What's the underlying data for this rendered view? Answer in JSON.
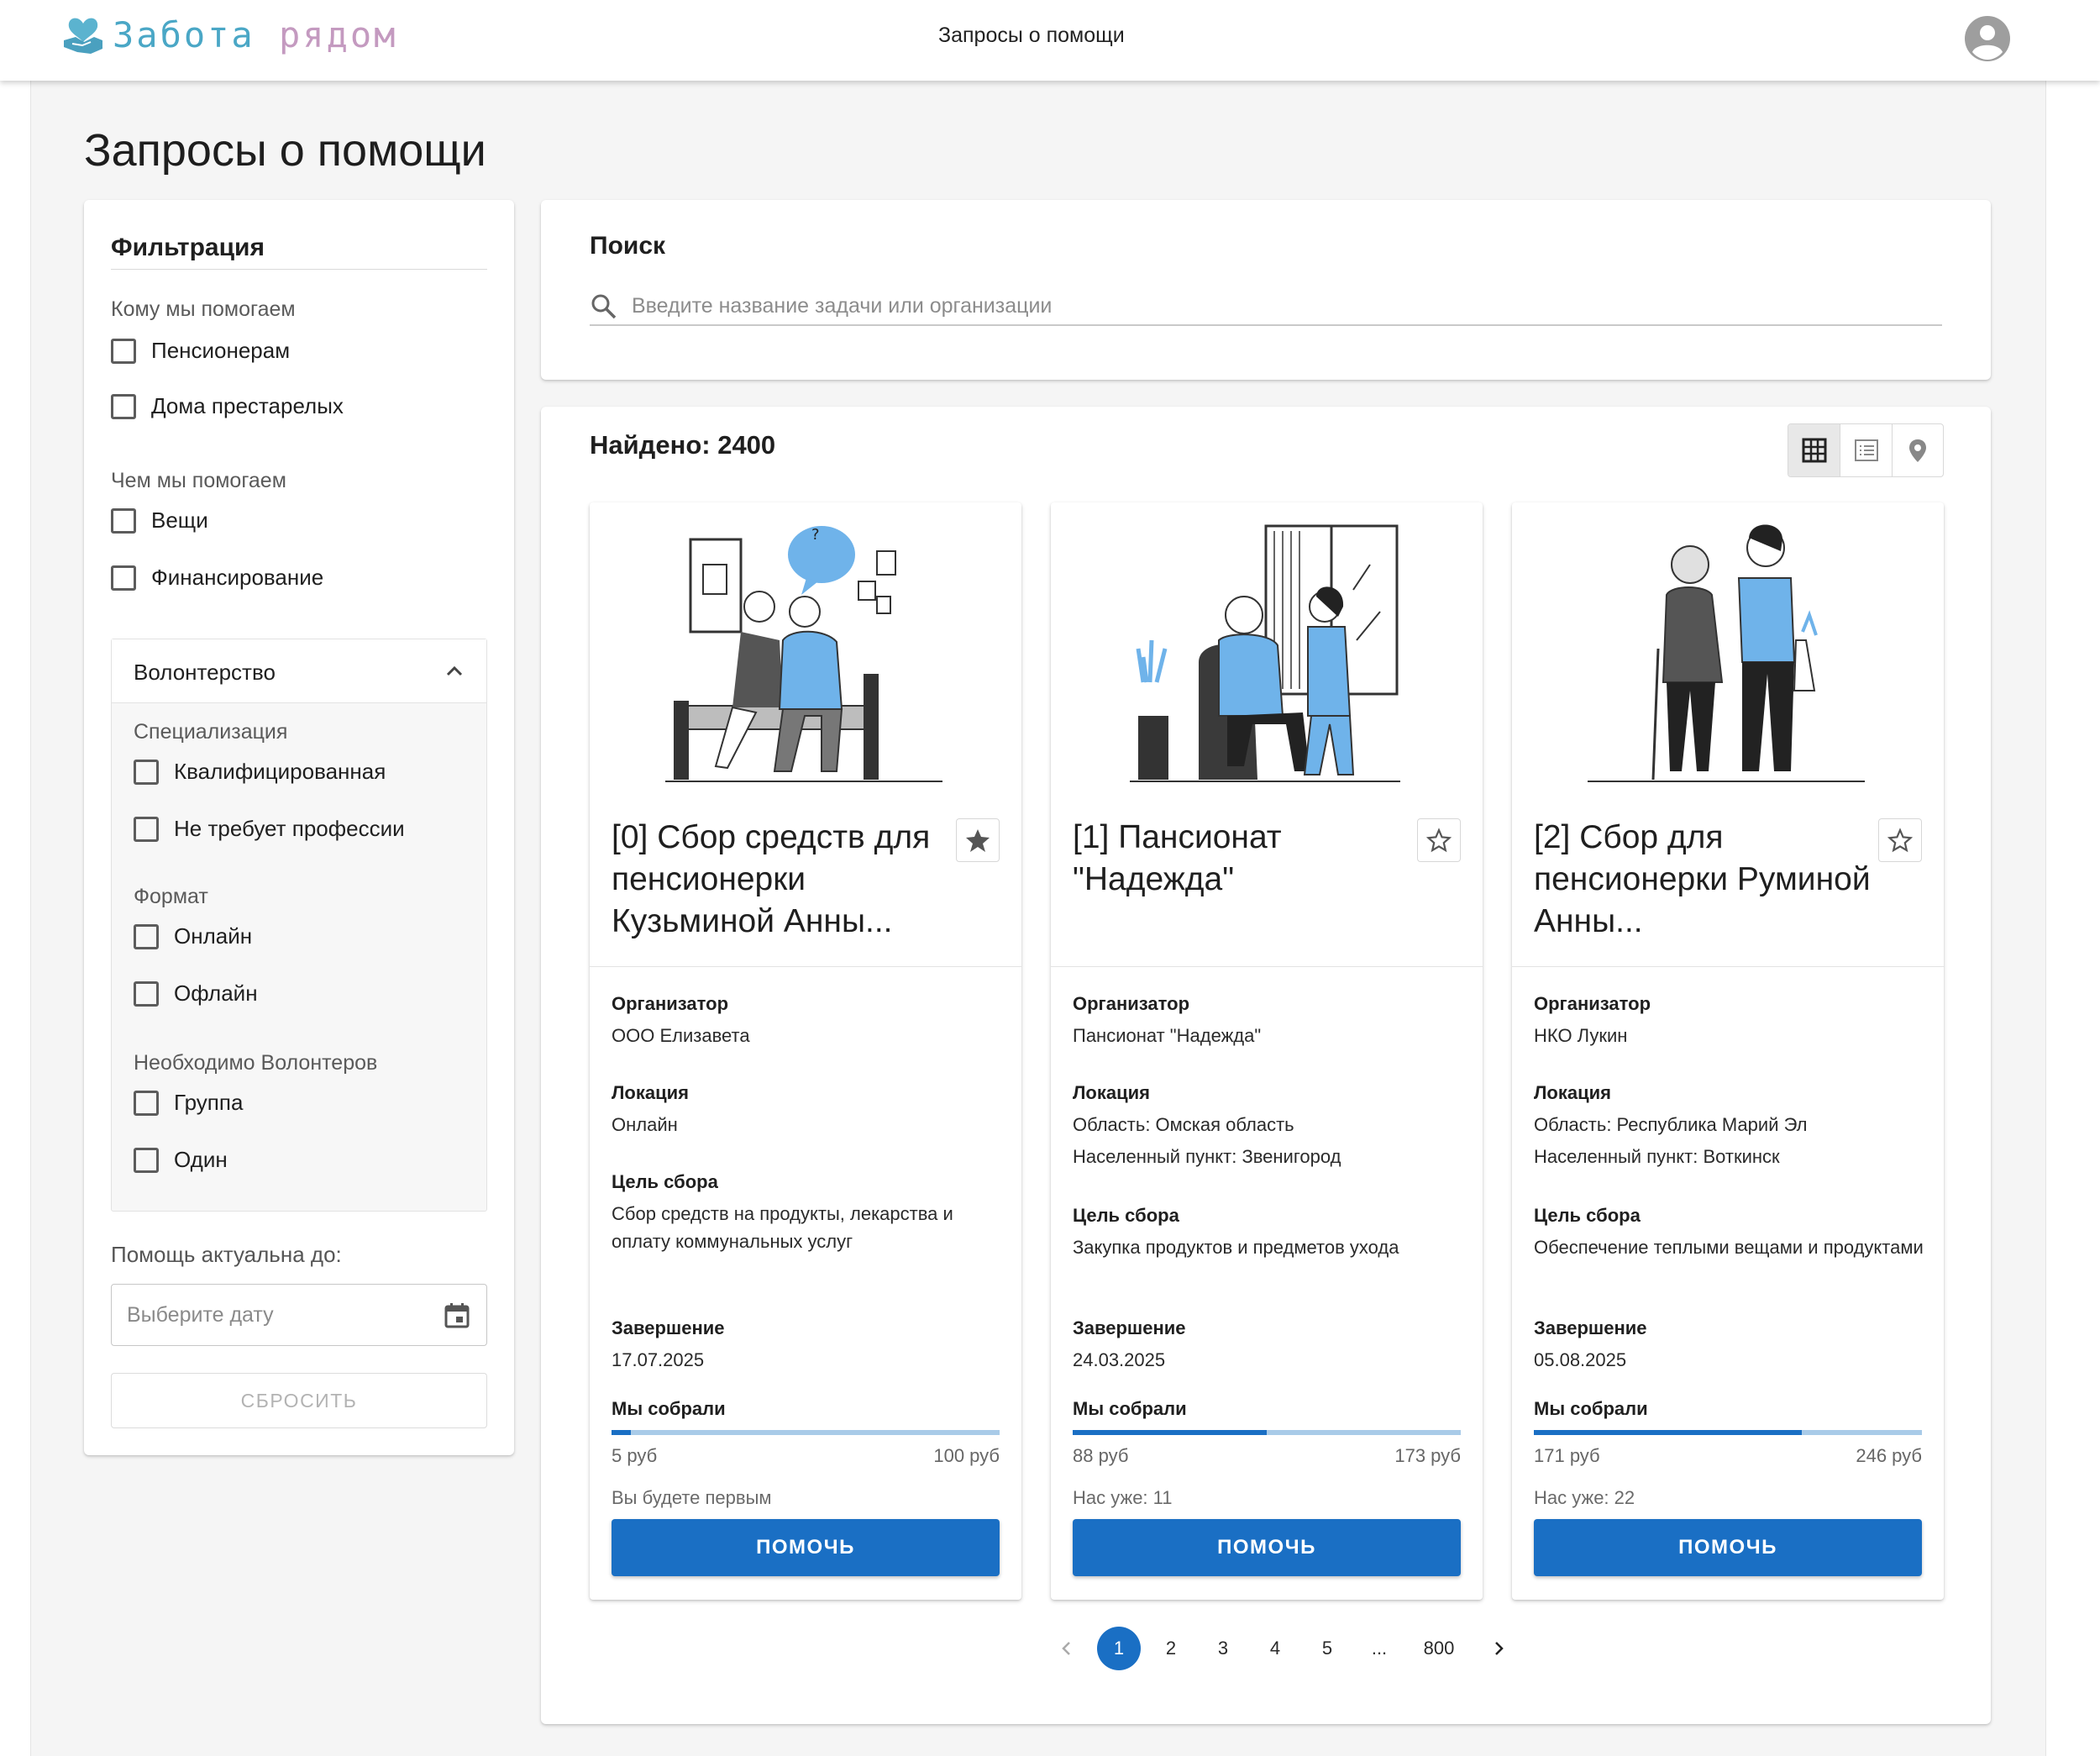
{
  "header": {
    "brand_part1": "Забота",
    "brand_part2": "рядом",
    "nav_title": "Запросы о помощи"
  },
  "page": {
    "title": "Запросы о помощи"
  },
  "filter": {
    "title": "Фильтрация",
    "group_who": "Кому мы помогаем",
    "who_options": [
      "Пенсионерам",
      "Дома престарелых"
    ],
    "group_what": "Чем мы помогаем",
    "what_options": [
      "Вещи",
      "Финансирование"
    ],
    "volunteering": {
      "label": "Волонтерство",
      "spec_label": "Специализация",
      "spec_options": [
        "Квалифицированная",
        "Не требует профессии"
      ],
      "format_label": "Формат",
      "format_options": [
        "Онлайн",
        "Офлайн"
      ],
      "need_label": "Необходимо Волонтеров",
      "need_options": [
        "Группа",
        "Один"
      ]
    },
    "date_label": "Помощь актуальна до:",
    "date_placeholder": "Выберите дату",
    "reset_label": "СБРОСИТЬ"
  },
  "search": {
    "title": "Поиск",
    "placeholder": "Введите название задачи или организации"
  },
  "results": {
    "found": "Найдено: 2400",
    "active_view": "grid"
  },
  "labels": {
    "organizer": "Организатор",
    "location": "Локация",
    "goal": "Цель сбора",
    "end": "Завершение",
    "collected": "Мы собрали",
    "help": "ПОМОЧЬ"
  },
  "cards": [
    {
      "title": "[0] Сбор средств для пенсионерки Кузьминой Анны...",
      "favorite": true,
      "organizer": "ООО Елизавета",
      "location_line1": "Онлайн",
      "location_line2": "",
      "goal": "Сбор средств на продукты, лекарства и оплату коммунальных услуг",
      "end_date": "17.07.2025",
      "collected_label": "5 руб",
      "target_label": "100 руб",
      "progress": 0.05,
      "note": "Вы будете первым"
    },
    {
      "title": "[1] Пансионат \"Надежда\"",
      "favorite": false,
      "organizer": "Пансионат \"Надежда\"",
      "location_line1": "Область: Омская область",
      "location_line2": "Населенный пункт: Звенигород",
      "goal": "Закупка продуктов и предметов ухода",
      "end_date": "24.03.2025",
      "collected_label": "88 руб",
      "target_label": "173 руб",
      "progress": 0.5,
      "note": "Нас уже: 11"
    },
    {
      "title": "[2] Сбор для пенсионерки Руминой Анны...",
      "favorite": false,
      "organizer": "НКО Лукин",
      "location_line1": "Область: Республика Марий Эл",
      "location_line2": "Населенный пункт: Воткинск",
      "goal": "Обеспечение теплыми вещами и продуктами",
      "end_date": "05.08.2025",
      "collected_label": "171 руб",
      "target_label": "246 руб",
      "progress": 0.69,
      "note": "Нас уже: 22"
    }
  ],
  "pagination": {
    "pages": [
      "1",
      "2",
      "3",
      "4",
      "5",
      "...",
      "800"
    ],
    "current": "1"
  },
  "colors": {
    "accent": "#1a6fc4",
    "progress_track": "#a9cbe8",
    "brand_blue": "#4aa7c6",
    "brand_pink": "#c49ac0",
    "illustration_blue": "#6fb3ea"
  }
}
